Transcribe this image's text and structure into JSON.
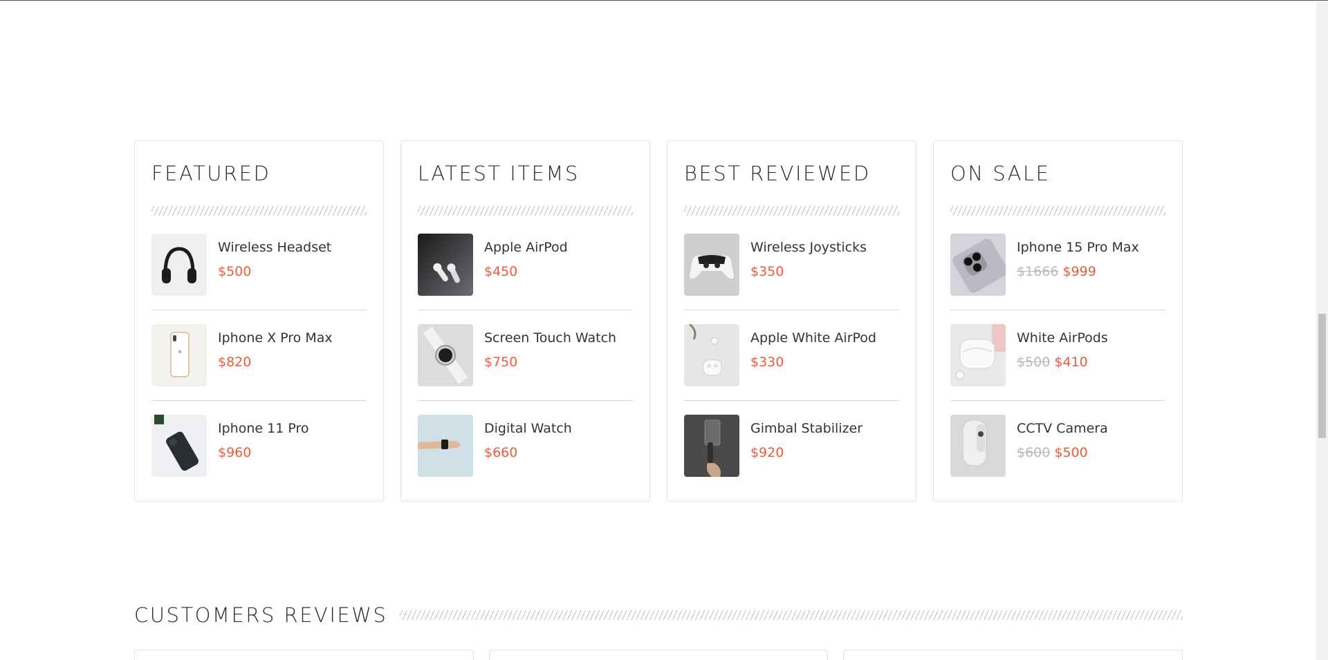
{
  "columns": [
    {
      "title": "FEATURED",
      "items": [
        {
          "name": "Wireless Headset",
          "price": "$500",
          "icon": "headset-image"
        },
        {
          "name": "Iphone X Pro Max",
          "price": "$820",
          "icon": "phone-white-image"
        },
        {
          "name": "Iphone 11 Pro",
          "price": "$960",
          "icon": "phone-black-image"
        }
      ]
    },
    {
      "title": "LATEST ITEMS",
      "items": [
        {
          "name": "Apple AirPod",
          "price": "$450",
          "icon": "airpod-dark-image"
        },
        {
          "name": "Screen Touch Watch",
          "price": "$750",
          "icon": "smartwatch-image"
        },
        {
          "name": "Digital Watch",
          "price": "$660",
          "icon": "wrist-watch-image"
        }
      ]
    },
    {
      "title": "BEST REVIEWED",
      "items": [
        {
          "name": "Wireless Joysticks",
          "price": "$350",
          "icon": "gamepad-image"
        },
        {
          "name": "Apple White AirPod",
          "price": "$330",
          "icon": "airpod-case-image"
        },
        {
          "name": "Gimbal Stabilizer",
          "price": "$920",
          "icon": "gimbal-image"
        }
      ]
    },
    {
      "title": "ON SALE",
      "items": [
        {
          "name": "Iphone 15 Pro Max",
          "old_price": "$1666",
          "price": "$999",
          "icon": "phone-camera-image"
        },
        {
          "name": "White AirPods",
          "old_price": "$500",
          "price": "$410",
          "icon": "airpods-white-image"
        },
        {
          "name": "CCTV Camera",
          "old_price": "$600",
          "price": "$500",
          "icon": "cctv-image"
        }
      ]
    }
  ],
  "reviews": {
    "title": "CUSTOMERS REVIEWS"
  },
  "colors": {
    "price": "#f05a3c",
    "old_price": "#b8b8b8",
    "border": "#e4e4e4"
  }
}
